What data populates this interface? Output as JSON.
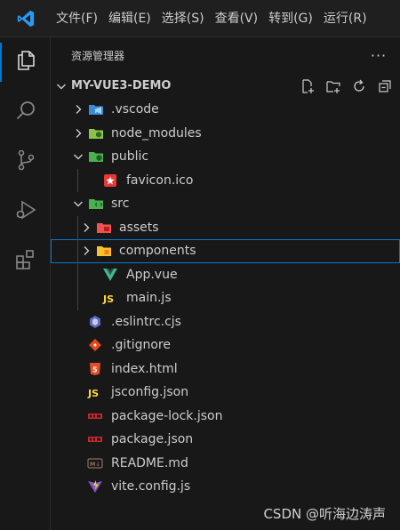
{
  "menu": {
    "items": [
      "文件(F)",
      "编辑(E)",
      "选择(S)",
      "查看(V)",
      "转到(G)",
      "运行(R)"
    ]
  },
  "activity_bar": {
    "items": [
      {
        "icon": "explorer-icon",
        "active": true
      },
      {
        "icon": "search-icon",
        "active": false
      },
      {
        "icon": "source-control-icon",
        "active": false
      },
      {
        "icon": "run-debug-icon",
        "active": false
      },
      {
        "icon": "extensions-icon",
        "active": false
      }
    ]
  },
  "sidebar": {
    "title": "资源管理器",
    "more": "···",
    "folder": "MY-VUE3-DEMO",
    "tree": [
      {
        "label": ".vscode",
        "depth": 0,
        "type": "folder",
        "expanded": false,
        "icon": "vscode-folder-icon"
      },
      {
        "label": "node_modules",
        "depth": 0,
        "type": "folder",
        "expanded": false,
        "icon": "node-folder-icon"
      },
      {
        "label": "public",
        "depth": 0,
        "type": "folder",
        "expanded": true,
        "icon": "public-folder-icon"
      },
      {
        "label": "favicon.ico",
        "depth": 1,
        "type": "file",
        "icon": "favicon-icon"
      },
      {
        "label": "src",
        "depth": 0,
        "type": "folder",
        "expanded": true,
        "icon": "src-folder-icon"
      },
      {
        "label": "assets",
        "depth": 1,
        "type": "folder",
        "expanded": false,
        "icon": "assets-folder-icon"
      },
      {
        "label": "components",
        "depth": 1,
        "type": "folder",
        "expanded": false,
        "icon": "components-folder-icon",
        "selected": true
      },
      {
        "label": "App.vue",
        "depth": 1,
        "type": "file",
        "icon": "vue-file-icon"
      },
      {
        "label": "main.js",
        "depth": 1,
        "type": "file",
        "icon": "js-file-icon",
        "badge": "JS"
      },
      {
        "label": ".eslintrc.cjs",
        "depth": 0,
        "type": "file",
        "icon": "eslint-file-icon"
      },
      {
        "label": ".gitignore",
        "depth": 0,
        "type": "file",
        "icon": "git-file-icon"
      },
      {
        "label": "index.html",
        "depth": 0,
        "type": "file",
        "icon": "html-file-icon",
        "badge": "5"
      },
      {
        "label": "jsconfig.json",
        "depth": 0,
        "type": "file",
        "icon": "jsconfig-file-icon",
        "badge": "JS"
      },
      {
        "label": "package-lock.json",
        "depth": 0,
        "type": "file",
        "icon": "npm-file-icon"
      },
      {
        "label": "package.json",
        "depth": 0,
        "type": "file",
        "icon": "npm-file-icon"
      },
      {
        "label": "README.md",
        "depth": 0,
        "type": "file",
        "icon": "markdown-file-icon",
        "badge": "M↓"
      },
      {
        "label": "vite.config.js",
        "depth": 0,
        "type": "file",
        "icon": "vite-file-icon"
      }
    ]
  },
  "watermark": "CSDN @听海边涛声",
  "colors": {
    "accent": "#0078d4",
    "background": "#181818",
    "text": "#cccccc"
  }
}
